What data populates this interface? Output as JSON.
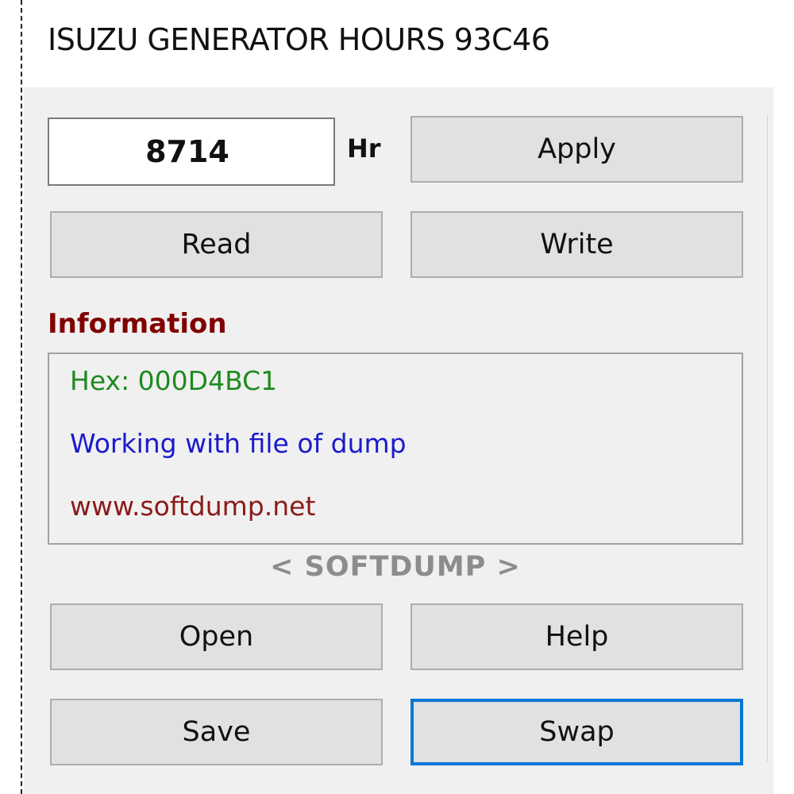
{
  "window": {
    "title": "ISUZU GENERATOR HOURS 93C46"
  },
  "hours": {
    "value": "8714",
    "unit": "Hr"
  },
  "buttons": {
    "apply": "Apply",
    "read": "Read",
    "write": "Write",
    "open": "Open",
    "help": "Help",
    "save": "Save",
    "swap": "Swap"
  },
  "information": {
    "label": "Information",
    "lines": [
      {
        "text": "Hex: 000D4BC1",
        "color": "#1f8a1f"
      },
      {
        "text": "Working with file of dump",
        "color": "#1a1acc"
      },
      {
        "text": "www.softdump.net",
        "color": "#8b1a1a"
      }
    ]
  },
  "brand": "< SOFTDUMP >",
  "colors": {
    "window_bg": "#f0f0f0",
    "info_label": "#800000",
    "focus_border": "#0078d7"
  }
}
